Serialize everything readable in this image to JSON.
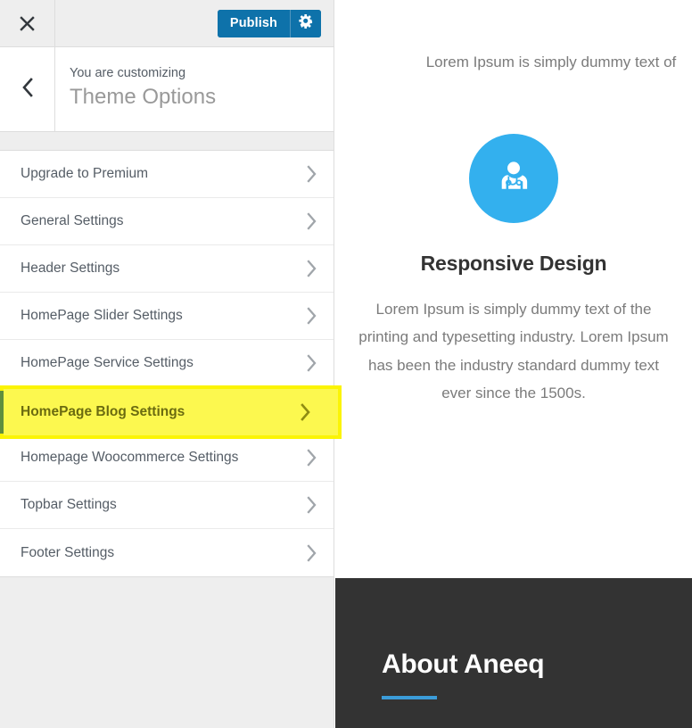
{
  "customizer": {
    "topbar": {
      "close_icon": "close-x-icon",
      "publish_label": "Publish",
      "gear_icon": "gear-icon",
      "publish_color": "#0e72aa"
    },
    "header": {
      "back_icon": "chevron-left-icon",
      "eyebrow": "You are customizing",
      "title": "Theme Options"
    },
    "menu": {
      "items": [
        {
          "label": "Upgrade to Premium",
          "chevron": "chevron-right-icon",
          "highlighted": false
        },
        {
          "label": "General Settings",
          "chevron": "chevron-right-icon",
          "highlighted": false
        },
        {
          "label": "Header Settings",
          "chevron": "chevron-right-icon",
          "highlighted": false
        },
        {
          "label": "HomePage Slider Settings",
          "chevron": "chevron-right-icon",
          "highlighted": false
        },
        {
          "label": "HomePage Service Settings",
          "chevron": "chevron-right-icon",
          "highlighted": false
        },
        {
          "label": "HomePage Blog Settings",
          "chevron": "chevron-right-icon",
          "highlighted": true
        },
        {
          "label": "Homepage Woocommerce Settings",
          "chevron": "chevron-right-icon",
          "highlighted": false
        },
        {
          "label": "Topbar Settings",
          "chevron": "chevron-right-icon",
          "highlighted": false
        },
        {
          "label": "Footer Settings",
          "chevron": "chevron-right-icon",
          "highlighted": false
        }
      ],
      "highlight_color": "#fcf84f",
      "highlight_border_color": "#fbf404",
      "highlight_accent_color": "#5f8e3e"
    }
  },
  "preview": {
    "lead_text": "Lorem Ipsum is simply dummy text of",
    "service": {
      "icon": "doctor-stethoscope-icon",
      "icon_bg_color": "#33b0ee",
      "title": "Responsive Design",
      "description": "Lorem Ipsum is simply dummy text of the printing and typesetting industry. Lorem Ipsum has been the industry standard dummy text ever since the 1500s."
    },
    "about": {
      "title": "About Aneeq",
      "background_color": "#333333",
      "rule_color": "#3b9cd9"
    }
  }
}
